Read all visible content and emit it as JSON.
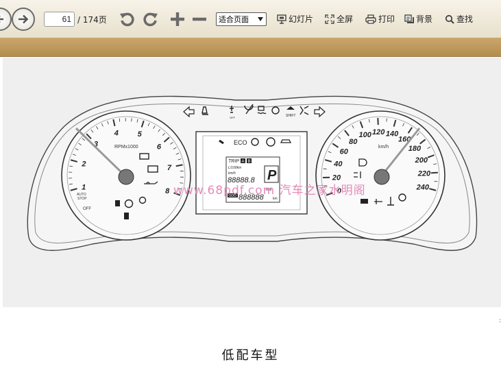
{
  "toolbar": {
    "current_page": "61",
    "total_pages": "/ 174页",
    "zoom_value": "适合页面",
    "slideshow": "幻灯片",
    "fullscreen": "全屏",
    "print": "打印",
    "background": "背景",
    "find": "查找",
    "icons": [
      "next-page-icon",
      "rotate-left-icon",
      "rotate-right-icon",
      "zoom-in-icon",
      "zoom-out-icon"
    ]
  },
  "cluster": {
    "tachometer": {
      "unit": "RPMx1000",
      "ticks": [
        "1",
        "2",
        "3",
        "4",
        "5",
        "6",
        "7",
        "8"
      ],
      "auto_stop_off": [
        "AUTO",
        "STOP",
        "OFF"
      ]
    },
    "speedometer": {
      "unit": "km/h",
      "ticks": [
        "0",
        "20",
        "40",
        "60",
        "80",
        "100",
        "120",
        "140",
        "160",
        "180",
        "200",
        "220",
        "240"
      ]
    },
    "display": {
      "eco": "ECO",
      "trip": "TRIP",
      "trip_a": "A",
      "trip_b": "B",
      "fuel_unit": "L/100km",
      "dist_unit": "km/h",
      "digits_main": "88888.8",
      "gear": "P",
      "odo": "ODO",
      "digits_odo": "888888",
      "odo_unit": "km",
      "dots": "888"
    },
    "shift": "SHIFT",
    "off": "OFF"
  },
  "watermark": "www.68pdf.com 汽车之家水明阁",
  "caption": "低配车型",
  "colors": {
    "toolbar": "#ece5d3",
    "band": "#bd9657",
    "watermark": "#e58ab8",
    "page": "#efefef"
  }
}
